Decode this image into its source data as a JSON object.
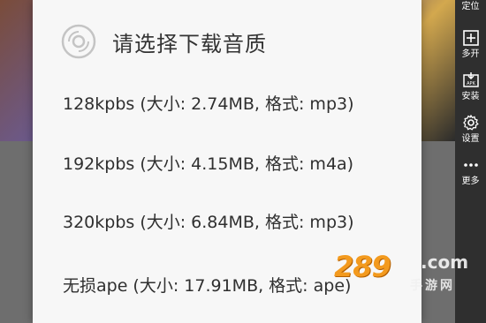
{
  "dialog": {
    "title": "请选择下载音质",
    "options": [
      {
        "label": "128kpbs (大小: 2.74MB, 格式: mp3)"
      },
      {
        "label": "192kpbs (大小: 4.15MB, 格式: m4a)"
      },
      {
        "label": "320kpbs (大小: 6.84MB, 格式: mp3)"
      },
      {
        "label": "无损ape (大小: 17.91MB, 格式: ape)"
      }
    ]
  },
  "toolbar": {
    "locate_label": "定位",
    "multi_label": "多开",
    "install_label": "安装",
    "settings_label": "设置",
    "more_label": "更多"
  },
  "watermark": {
    "logo": "289",
    "com": ".com",
    "sub": "手游网"
  },
  "colors": {
    "dialog_bg": "#f7f7f7",
    "toolbar_bg": "#2f2f2f",
    "watermark_orange": "#f39a1e"
  }
}
